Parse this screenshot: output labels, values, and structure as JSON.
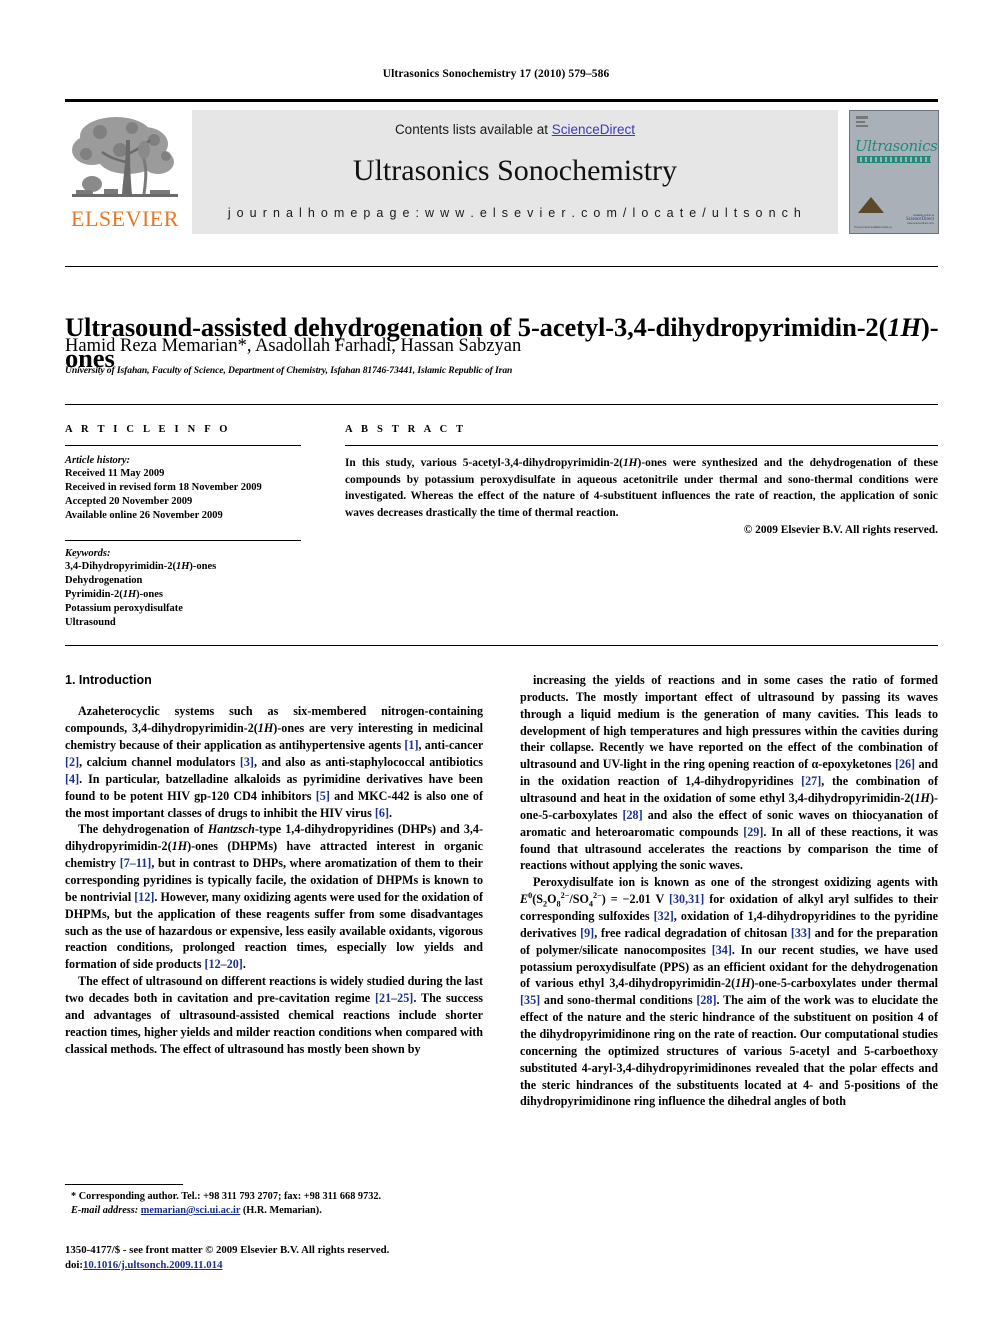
{
  "running_head": "Ultrasonics Sonochemistry 17 (2010) 579–586",
  "header": {
    "contents_prefix": "Contents lists available at ",
    "sciencedirect": "ScienceDirect",
    "journal_name": "Ultrasonics Sonochemistry",
    "homepage": "j o u r n a l   h o m e p a g e :   w w w . e l s e v i e r . c o m / l o c a t e / u l t s o n c h",
    "publisher_logo_text": "ELSEVIER",
    "cover": {
      "title": "Ultrasonics",
      "subtitle": "SONOCHEMISTRY",
      "footnote": "This journal is available online at",
      "sd_line1": "Available online at",
      "sd_line2": "ScienceDirect",
      "sd_line3": "www.sciencedirect.com"
    },
    "accent_link_color": "#3b3bb5",
    "elsevier_orange": "#E87722",
    "banner_bg": "#e6e6e6"
  },
  "article": {
    "title": "Ultrasound-assisted dehydrogenation of 5-acetyl-3,4-dihydropyrimidin-2(1H)-ones",
    "title_parts": {
      "before_italic": "Ultrasound-assisted dehydrogenation of 5-acetyl-3,4-dihydropyrimidin-2(",
      "italic": "1H",
      "after_italic": ")-ones"
    },
    "authors": "Hamid Reza Memarian*, Asadollah Farhadi, Hassan Sabzyan",
    "affiliation": "University of Isfahan, Faculty of Science, Department of Chemistry, Isfahan 81746-73441, Islamic Republic of Iran"
  },
  "article_info": {
    "heading": "A R T I C L E   I N F O",
    "history_label": "Article history:",
    "history": [
      "Received 11 May 2009",
      "Received in revised form 18 November 2009",
      "Accepted 20 November 2009",
      "Available online 26 November 2009"
    ],
    "keywords_label": "Keywords:",
    "keywords": [
      "3,4-Dihydropyrimidin-2(1H)-ones",
      "Dehydrogenation",
      "Pyrimidin-2(1H)-ones",
      "Potassium peroxydisulfate",
      "Ultrasound"
    ]
  },
  "abstract": {
    "heading": "A B S T R A C T",
    "text": "In this study, various 5-acetyl-3,4-dihydropyrimidin-2(1H)-ones were synthesized and the dehydrogenation of these compounds by potassium peroxydisulfate in aqueous acetonitrile under thermal and sono-thermal conditions were investigated. Whereas the effect of the nature of 4-substituent influences the rate of reaction, the application of sonic waves decreases drastically the time of thermal reaction.",
    "copyright": "© 2009 Elsevier B.V. All rights reserved."
  },
  "body": {
    "section_title": "1. Introduction",
    "left_paragraphs": [
      "Azaheterocyclic systems such as six-membered nitrogen-containing compounds, 3,4-dihydropyrimidin-2(1H)-ones are very interesting in medicinal chemistry because of their application as antihypertensive agents [1], anti-cancer [2], calcium channel modulators [3], and also as anti-staphylococcal antibiotics [4]. In particular, batzelladine alkaloids as pyrimidine derivatives have been found to be potent HIV gp-120 CD4 inhibitors [5] and MKC-442 is also one of the most important classes of drugs to inhibit the HIV virus [6].",
      "The dehydrogenation of Hantzsch-type 1,4-dihydropyridines (DHPs) and 3,4-dihydropyrimidin-2(1H)-ones (DHPMs) have attracted interest in organic chemistry [7–11], but in contrast to DHPs, where aromatization of them to their corresponding pyridines is typically facile, the oxidation of DHPMs is known to be nontrivial [12]. However, many oxidizing agents were used for the oxidation of DHPMs, but the application of these reagents suffer from some disadvantages such as the use of hazardous or expensive, less easily available oxidants, vigorous reaction conditions, prolonged reaction times, especially low yields and formation of side products [12–20].",
      "The effect of ultrasound on different reactions is widely studied during the last two decades both in cavitation and pre-cavitation regime [21–25]. The success and advantages of ultrasound-assisted chemical reactions include shorter reaction times, higher yields and milder reaction conditions when compared with classical methods. The effect of ultrasound has mostly been shown by"
    ],
    "right_paragraphs": [
      "increasing the yields of reactions and in some cases the ratio of formed products. The mostly important effect of ultrasound by passing its waves through a liquid medium is the generation of many cavities. This leads to development of high temperatures and high pressures within the cavities during their collapse. Recently we have reported on the effect of the combination of ultrasound and UV-light in the ring opening reaction of α-epoxyketones [26] and in the oxidation reaction of 1,4-dihydropyridines [27], the combination of ultrasound and heat in the oxidation of some ethyl 3,4-dihydropyrimidin-2(1H)-one-5-carboxylates [28] and also the effect of sonic waves on thiocyanation of aromatic and heteroaromatic compounds [29]. In all of these reactions, it was found that ultrasound accelerates the reactions by comparison the time of reactions without applying the sonic waves.",
      "Peroxydisulfate ion is known as one of the strongest oxidizing agents with E0(S2O82−/SO42−) = −2.01 V [30,31] for oxidation of alkyl aryl sulfides to their corresponding sulfoxides [32], oxidation of 1,4-dihydropyridines to the pyridine derivatives [9], free radical degradation of chitosan [33] and for the preparation of polymer/silicate nanocomposites [34]. In our recent studies, we have used potassium peroxydisulfate (PPS) as an efficient oxidant for the dehydrogenation of various ethyl 3,4-dihydropyrimidin-2(1H)-one-5-carboxylates under thermal [35] and sono-thermal conditions [28]. The aim of the work was to elucidate the effect of the nature and the steric hindrance of the substituent on position 4 of the dihydropyrimidinone ring on the rate of reaction. Our computational studies concerning the optimized structures of various 5-acetyl and 5-carboethoxy substituted 4-aryl-3,4-dihydropyrimidinones revealed that the polar effects and the steric hindrances of the substituents located at 4- and 5-positions of the dihydropyrimidinone ring influence the dihedral angles of both"
    ],
    "reference_link_color": "#1b2f8f"
  },
  "footnote": {
    "corresponding": "* Corresponding author. Tel.: +98 311 793 2707; fax: +98 311 668 9732.",
    "email_label": "E-mail address:",
    "email": "memarian@sci.ui.ac.ir",
    "email_suffix": "(H.R. Memarian)."
  },
  "footer": {
    "issn_line": "1350-4177/$ - see front matter © 2009 Elsevier B.V. All rights reserved.",
    "doi_label": "doi:",
    "doi": "10.1016/j.ultsonch.2009.11.014"
  }
}
